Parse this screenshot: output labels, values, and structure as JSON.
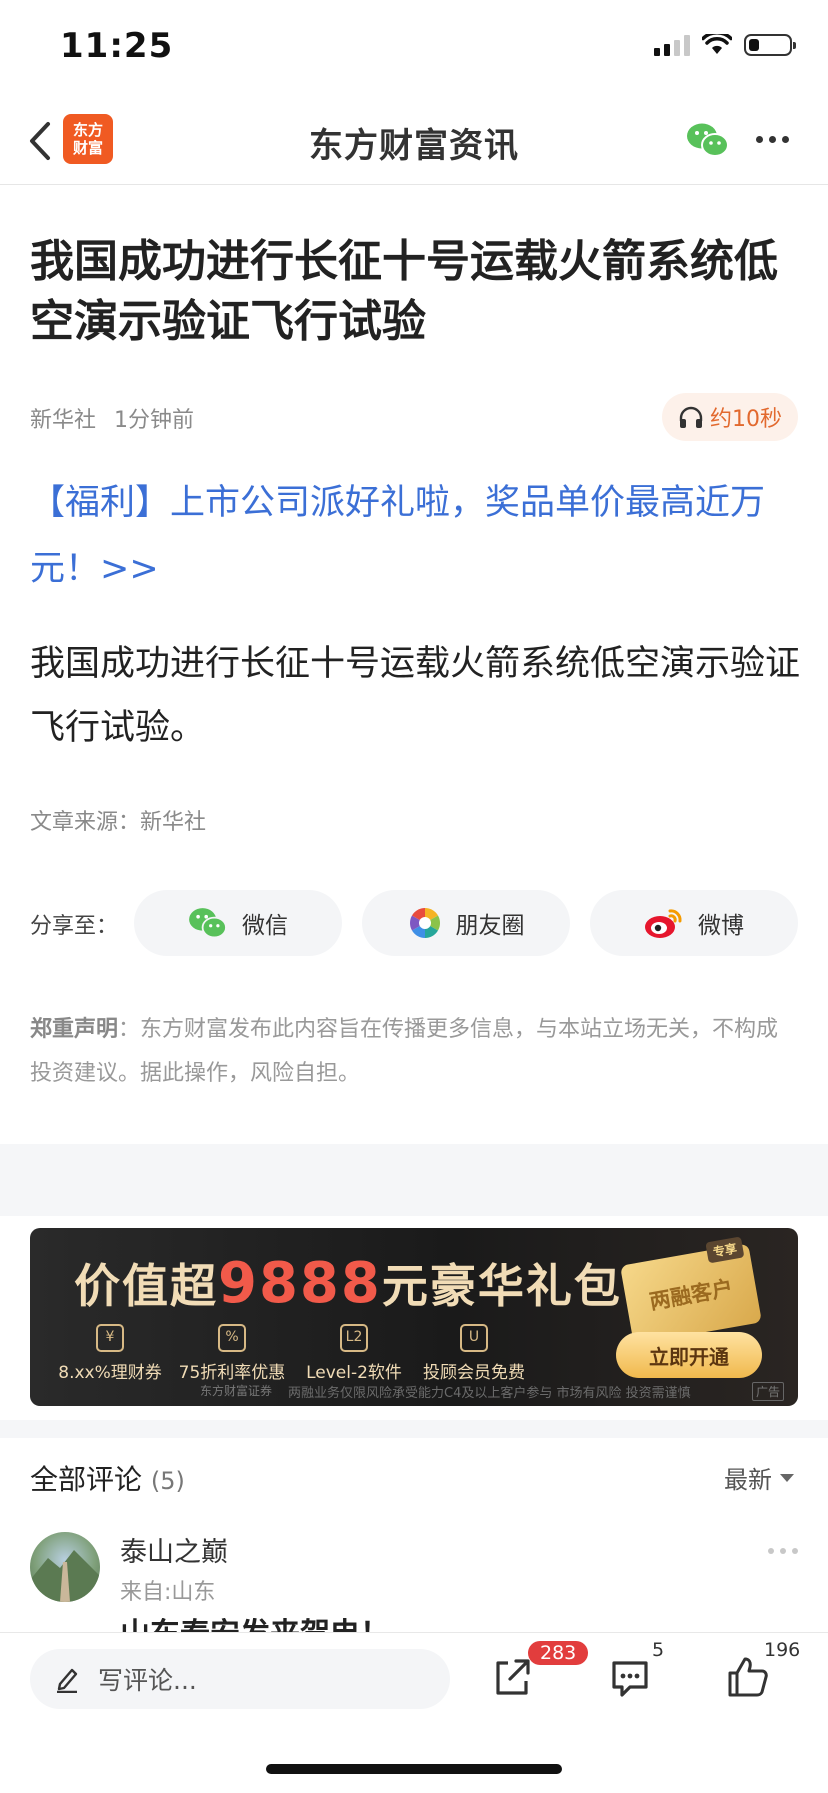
{
  "status": {
    "time": "11:25"
  },
  "nav": {
    "title": "东方财富资讯",
    "logo_line1": "东方",
    "logo_line2": "财富"
  },
  "article": {
    "title": "我国成功进行长征十号运载火箭系统低空演示验证飞行试验",
    "source_name": "新华社",
    "time_ago": "1分钟前",
    "audio_label": "约10秒",
    "promo": "【福利】上市公司派好礼啦，奖品单价最高近万元！>>",
    "body": "我国成功进行长征十号运载火箭系统低空演示验证飞行试验。",
    "source_line": "文章来源：新华社"
  },
  "share": {
    "label": "分享至：",
    "wechat": "微信",
    "moments": "朋友圈",
    "weibo": "微博"
  },
  "disclaimer": {
    "title": "郑重声明",
    "text": "：东方财富发布此内容旨在传播更多信息，与本站立场无关，不构成投资建议。据此操作，风险自担。"
  },
  "ad": {
    "title_prefix": "价值超",
    "title_big": "9888",
    "title_suffix": "元豪华礼包",
    "features": [
      "8.xx%理财券",
      "75折利率优惠",
      "Level-2软件",
      "投顾会员免费"
    ],
    "feature_icons": [
      "¥",
      "%",
      "L2",
      "U"
    ],
    "card_text": "两融客户",
    "card_tag": "专享",
    "cta": "立即开通",
    "brand": "东方财富证券",
    "footnote": "两融业务仅限风险承受能力C4及以上客户参与 市场有风险 投资需谨慎",
    "ad_tag": "广告"
  },
  "comments": {
    "header": "全部评论",
    "count": "(5)",
    "sort": "最新",
    "first": {
      "name": "泰山之巅",
      "from": "来自:山东",
      "text": "山东泰安发来贺电！"
    }
  },
  "bottom": {
    "placeholder": "写评论...",
    "share_count": "283",
    "comment_count": "5",
    "like_count": "196"
  },
  "colors": {
    "brand": "#f05a22",
    "link": "#3b6fd6",
    "badge": "#e23d3d"
  }
}
